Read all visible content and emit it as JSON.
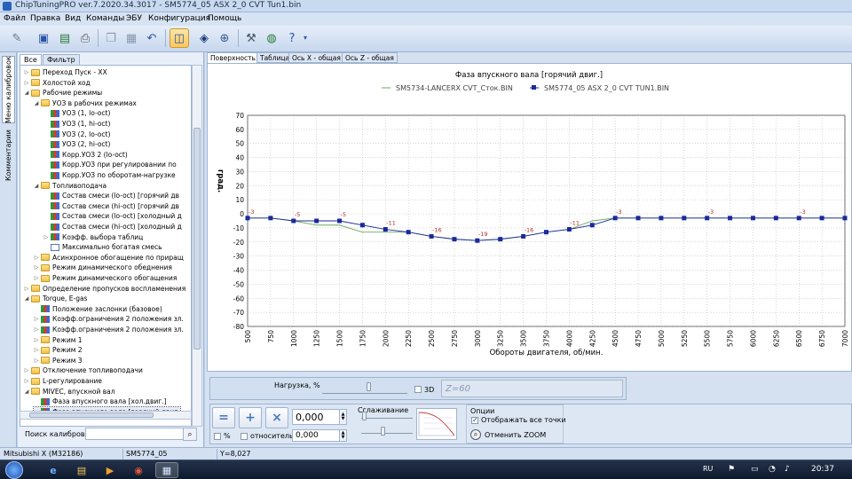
{
  "window": {
    "title": "ChipTuningPRO ver.7.2020.34.3017 - SM5774_05 ASX 2_0 CVT Tun1.bin"
  },
  "menu": [
    "Файл",
    "Правка",
    "Вид",
    "Команды",
    "ЭБУ",
    "Конфигурация",
    "Помощь"
  ],
  "vertical_tabs": [
    "Меню калибровок",
    "Комментарии"
  ],
  "left_tabs": [
    "Все",
    "Фильтр"
  ],
  "tree": [
    {
      "label": "Переход Пуск - XX",
      "indent": 1,
      "icon": "folder",
      "toggle": "▷"
    },
    {
      "label": "Холостой ход",
      "indent": 1,
      "icon": "folder",
      "toggle": "▷"
    },
    {
      "label": "Рабочие режимы",
      "indent": 1,
      "icon": "folder",
      "toggle": "◢"
    },
    {
      "label": "УОЗ в рабочих режимах",
      "indent": 2,
      "icon": "folder",
      "toggle": "◢"
    },
    {
      "label": "УОЗ (1, lo-oct)",
      "indent": 3,
      "icon": "map",
      "toggle": ""
    },
    {
      "label": "УОЗ (1, hi-oct)",
      "indent": 3,
      "icon": "map",
      "toggle": ""
    },
    {
      "label": "УОЗ (2, lo-oct)",
      "indent": 3,
      "icon": "map",
      "toggle": ""
    },
    {
      "label": "УОЗ (2, hi-oct)",
      "indent": 3,
      "icon": "map",
      "toggle": ""
    },
    {
      "label": "Корр.УОЗ 2 (lo-oct)",
      "indent": 3,
      "icon": "map",
      "toggle": ""
    },
    {
      "label": "Корр.УОЗ при регулировании по",
      "indent": 3,
      "icon": "map",
      "toggle": ""
    },
    {
      "label": "Корр.УОЗ по оборотам-нагрузке",
      "indent": 3,
      "icon": "map",
      "toggle": ""
    },
    {
      "label": "Топливоподача",
      "indent": 2,
      "icon": "folder",
      "toggle": "◢"
    },
    {
      "label": "Состав смеси (lo-oct) [горячий дв",
      "indent": 3,
      "icon": "map",
      "toggle": ""
    },
    {
      "label": "Состав смеси (hi-oct) [горячий дв",
      "indent": 3,
      "icon": "map",
      "toggle": ""
    },
    {
      "label": "Состав смеси (lo-oct) [холодный д",
      "indent": 3,
      "icon": "map",
      "toggle": ""
    },
    {
      "label": "Состав смеси (hi-oct) [холодный д",
      "indent": 3,
      "icon": "map",
      "toggle": ""
    },
    {
      "label": "Коэфф. выбора таблиц",
      "indent": 3,
      "icon": "map",
      "toggle": "▷"
    },
    {
      "label": "Максимально богатая смесь",
      "indent": 3,
      "icon": "table",
      "toggle": ""
    },
    {
      "label": "Асинхронное обогащение по приращ",
      "indent": 2,
      "icon": "folder",
      "toggle": "▷"
    },
    {
      "label": "Режим динамического обеднения",
      "indent": 2,
      "icon": "folder",
      "toggle": "▷"
    },
    {
      "label": "Режим динамического обогащения",
      "indent": 2,
      "icon": "folder",
      "toggle": "▷"
    },
    {
      "label": "Определение пропусков воспламенения",
      "indent": 1,
      "icon": "folder",
      "toggle": "▷"
    },
    {
      "label": "Torque, E-gas",
      "indent": 1,
      "icon": "folder",
      "toggle": "◢"
    },
    {
      "label": "Положение заслонки (базовое)",
      "indent": 2,
      "icon": "map",
      "toggle": ""
    },
    {
      "label": "Коэфф.ограничения 2 положения зл.",
      "indent": 2,
      "icon": "map",
      "toggle": "▷"
    },
    {
      "label": "Коэфф.ограничения 2 положения зл.",
      "indent": 2,
      "icon": "map",
      "toggle": "▷"
    },
    {
      "label": "Режим 1",
      "indent": 2,
      "icon": "folder",
      "toggle": "▷"
    },
    {
      "label": "Режим 2",
      "indent": 2,
      "icon": "folder",
      "toggle": "▷"
    },
    {
      "label": "Режим 3",
      "indent": 2,
      "icon": "folder",
      "toggle": "▷"
    },
    {
      "label": "Отключение топливоподачи",
      "indent": 1,
      "icon": "folder",
      "toggle": "▷"
    },
    {
      "label": "L-регулирование",
      "indent": 1,
      "icon": "folder",
      "toggle": "▷"
    },
    {
      "label": "MIVEC, впускной вал",
      "indent": 1,
      "icon": "folder",
      "toggle": "◢"
    },
    {
      "label": "Фаза впускного вала [хол.двиг.]",
      "indent": 2,
      "icon": "map",
      "toggle": ""
    },
    {
      "label": "Фаза впускного вала [горячий двиг.",
      "indent": 2,
      "icon": "map",
      "toggle": "",
      "selected": true
    }
  ],
  "search": {
    "label": "Поиск калибровки",
    "value": ""
  },
  "main_tabs": [
    "Поверхность",
    "Таблица",
    "Ось X - общая",
    "Ось Z - общая"
  ],
  "chart_data": {
    "type": "line",
    "title": "Фаза впускного вала [горячий двиг.]",
    "xlabel": "Обороты двигателя, об/мин.",
    "ylabel": "град.",
    "ylim": [
      -80,
      70
    ],
    "yticks": [
      70,
      60,
      50,
      40,
      30,
      20,
      10,
      0,
      -10,
      -20,
      -30,
      -40,
      -50,
      -60,
      -70,
      -80
    ],
    "x": [
      500,
      750,
      1000,
      1250,
      1500,
      1750,
      2000,
      2250,
      2500,
      2750,
      3000,
      3250,
      3500,
      3750,
      4000,
      4250,
      4500,
      4750,
      5000,
      5250,
      5500,
      5750,
      6000,
      6250,
      6500,
      6750,
      7000
    ],
    "series": [
      {
        "name": "SM5734-LANCERX CVT_Сток.BIN",
        "color": "#6aaa5a",
        "values": [
          -3,
          -3,
          -5,
          -8,
          -8,
          -13,
          -13,
          -13,
          -16,
          -18,
          -19,
          -18,
          -16,
          -13,
          -11,
          -5,
          -3,
          -3,
          -3,
          -3,
          -3,
          -3,
          -3,
          -3,
          -3,
          -3,
          -3
        ]
      },
      {
        "name": "SM5774_05 ASX 2_0 CVT TUN1.BIN",
        "color": "#1a2a9a",
        "values": [
          -3,
          -3,
          -5,
          -5,
          -5,
          -8,
          -11,
          -13,
          -16,
          -18,
          -19,
          -18,
          -16,
          -13,
          -11,
          -8,
          -3,
          -3,
          -3,
          -3,
          -3,
          -3,
          -3,
          -3,
          -3,
          -3,
          -3
        ]
      }
    ],
    "point_labels": [
      {
        "x": 500,
        "y": -3,
        "text": "-3"
      },
      {
        "x": 1000,
        "y": -5,
        "text": "-5"
      },
      {
        "x": 1500,
        "y": -5,
        "text": "-5"
      },
      {
        "x": 2000,
        "y": -11,
        "text": "-11"
      },
      {
        "x": 2500,
        "y": -16,
        "text": "-16"
      },
      {
        "x": 3000,
        "y": -19,
        "text": "-19"
      },
      {
        "x": 3500,
        "y": -16,
        "text": "-16"
      },
      {
        "x": 4000,
        "y": -11,
        "text": "-11"
      },
      {
        "x": 4500,
        "y": -3,
        "text": "-3"
      },
      {
        "x": 5500,
        "y": -3,
        "text": "-3"
      },
      {
        "x": 6500,
        "y": -3,
        "text": "-3"
      }
    ],
    "grid": true,
    "legend_position": "top"
  },
  "controls": {
    "load_label": "Нагрузка, %",
    "three_d_label": "3D",
    "z_label": "Z=60",
    "value1": "0,000",
    "value2": "0,000",
    "percent_label": "%",
    "relative_label": "относительно",
    "smoothing_label": "Сглаживание",
    "options_label": "Опции",
    "show_all_points_label": "Отображать все точки",
    "cancel_zoom_label": "Отменить ZOOM"
  },
  "status": {
    "ecu": "Mitsubishi X (M32186)",
    "file": "SM5774_05",
    "coord": "Y=8,027"
  },
  "taskbar": {
    "lang": "RU",
    "time": "20:37"
  }
}
